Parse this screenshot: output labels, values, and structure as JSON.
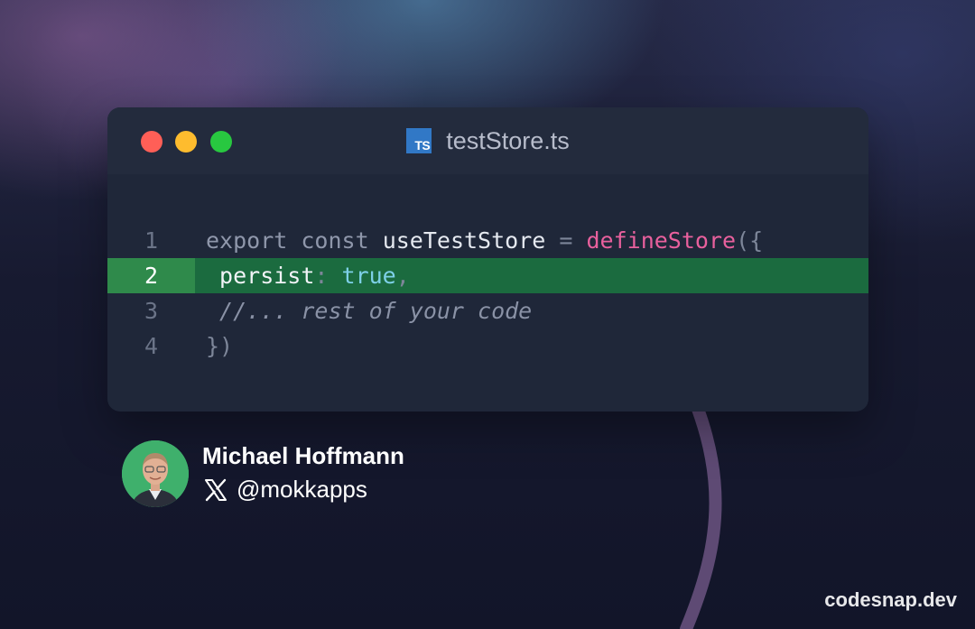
{
  "window": {
    "controls": [
      "close",
      "minimize",
      "maximize"
    ],
    "file_icon_label": "TS",
    "file_name": "testStore.ts"
  },
  "code": {
    "highlighted_line": 2,
    "lines": [
      {
        "number": "1",
        "tokens": [
          {
            "text": "export",
            "kind": "kw"
          },
          {
            "text": " ",
            "kind": "punc"
          },
          {
            "text": "const",
            "kind": "kw"
          },
          {
            "text": " ",
            "kind": "punc"
          },
          {
            "text": "useTestStore",
            "kind": "fn"
          },
          {
            "text": " = ",
            "kind": "punc"
          },
          {
            "text": "defineStore",
            "kind": "call"
          },
          {
            "text": "({",
            "kind": "punc"
          }
        ]
      },
      {
        "number": "2",
        "tokens": [
          {
            "text": " persist",
            "kind": "prop"
          },
          {
            "text": ": ",
            "kind": "punc"
          },
          {
            "text": "true",
            "kind": "bool"
          },
          {
            "text": ",",
            "kind": "punc"
          }
        ]
      },
      {
        "number": "3",
        "tokens": [
          {
            "text": " //... rest of your code",
            "kind": "comment"
          }
        ]
      },
      {
        "number": "4",
        "tokens": [
          {
            "text": "})",
            "kind": "punc"
          }
        ]
      }
    ]
  },
  "author": {
    "name": "Michael Hoffmann",
    "handle": "@mokkapps",
    "social_icon": "x-logo-icon"
  },
  "branding": "codesnap.dev",
  "colors": {
    "highlight_row": "#1b6b3f",
    "highlight_gutter": "#2f8a4b",
    "arrow": "#5e4a74",
    "ts_icon": "#3178c6"
  }
}
